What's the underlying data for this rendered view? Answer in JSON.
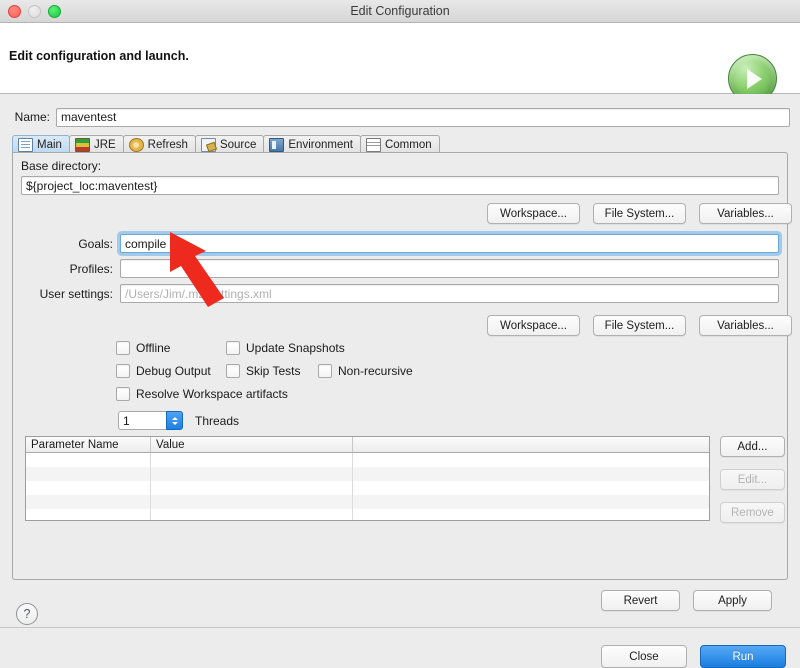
{
  "window": {
    "title": "Edit Configuration",
    "traffic_lights": [
      "close",
      "minimize",
      "zoom"
    ]
  },
  "header": {
    "title": "Edit configuration and launch.",
    "run_icon": "run-play-icon"
  },
  "name_field": {
    "label": "Name:",
    "value": "maventest"
  },
  "tabs": [
    {
      "label": "Main",
      "icon": "document-icon",
      "active": true
    },
    {
      "label": "JRE",
      "icon": "jre-books-icon",
      "active": false
    },
    {
      "label": "Refresh",
      "icon": "refresh-icon",
      "active": false
    },
    {
      "label": "Source",
      "icon": "source-icon",
      "active": false
    },
    {
      "label": "Environment",
      "icon": "environment-icon",
      "active": false
    },
    {
      "label": "Common",
      "icon": "common-icon",
      "active": false
    }
  ],
  "main_tab": {
    "base_directory": {
      "label": "Base directory:",
      "value": "${project_loc:maventest}"
    },
    "base_buttons": [
      "Workspace...",
      "File System...",
      "Variables..."
    ],
    "goals": {
      "label": "Goals:",
      "value": "compile",
      "focused": true
    },
    "profiles": {
      "label": "Profiles:",
      "value": ""
    },
    "user_settings": {
      "label": "User settings:",
      "value": "",
      "placeholder": "/Users/Jim/.m2/settings.xml"
    },
    "settings_buttons": [
      "Workspace...",
      "File System...",
      "Variables..."
    ],
    "checkboxes": [
      {
        "label": "Offline",
        "checked": false
      },
      {
        "label": "Update Snapshots",
        "checked": false
      },
      {
        "label": "Debug Output",
        "checked": false
      },
      {
        "label": "Skip Tests",
        "checked": false
      },
      {
        "label": "Non-recursive",
        "checked": false
      },
      {
        "label": "Resolve Workspace artifacts",
        "checked": false
      }
    ],
    "threads": {
      "value": "1",
      "label": "Threads"
    },
    "parameter_table": {
      "columns": [
        "Parameter Name",
        "Value",
        ""
      ],
      "rows": [],
      "empty_row_count": 5
    },
    "table_buttons": [
      {
        "label": "Add...",
        "enabled": true
      },
      {
        "label": "Edit...",
        "enabled": false
      },
      {
        "label": "Remove",
        "enabled": false
      }
    ]
  },
  "footer": {
    "revert": "Revert",
    "apply": "Apply",
    "close": "Close",
    "run": "Run",
    "help_icon": "help-question-icon"
  },
  "annotation": {
    "type": "arrow",
    "color": "#ee2a1e",
    "points_to": "goals-input"
  },
  "colors": {
    "accent_blue": "#1a7ee0",
    "window_bg": "#ececec",
    "annotation_red": "#ee2a1e",
    "run_green": "#4d9c3f"
  }
}
